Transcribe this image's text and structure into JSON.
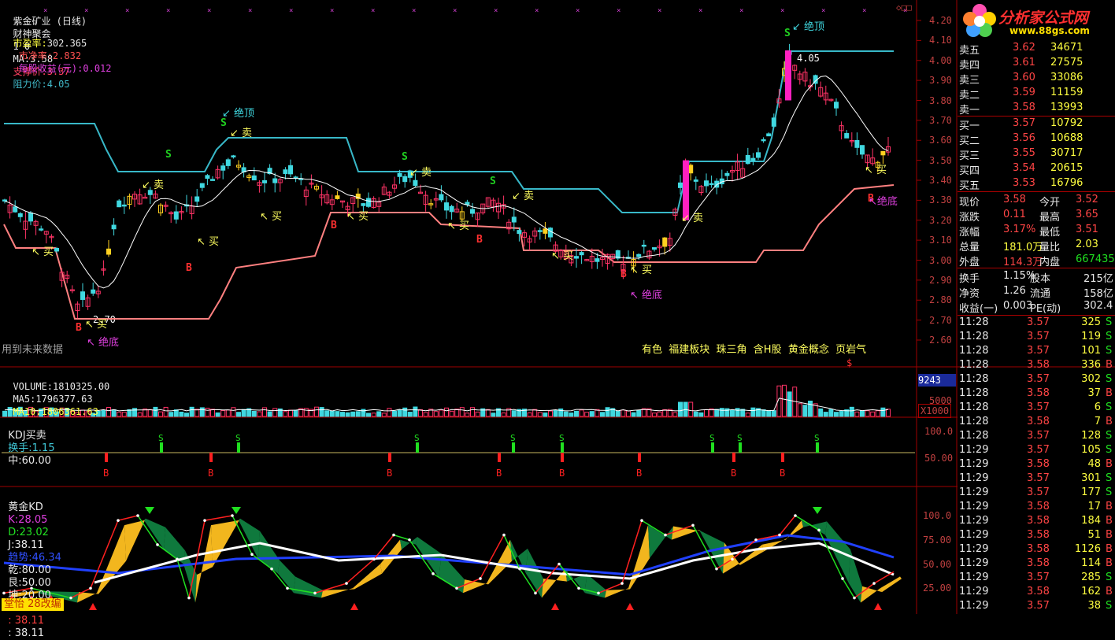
{
  "header": {
    "stock_name": "紫金矿业 (日线)",
    "indicator_name": "财神聚会",
    "params": "1 0",
    "ma_label": "MA:",
    "ma_value": "3.58",
    "support_label": "支撑价:",
    "support_value": "3.37",
    "resist_label": "阻力价:",
    "resist_value": "4.05",
    "pe_label": "市盈率:",
    "pe_value": "302.365",
    "pb_label": "市净率:",
    "pb_value": "2.832",
    "eps_label": "每股收益(元):",
    "eps_value": "0.012"
  },
  "main_chart": {
    "future_data_note": "用到未来数据",
    "concept_tags": [
      "有色",
      "福建板块",
      "珠三角",
      "含H股",
      "黄金概念",
      "页岩气"
    ],
    "concept_marker": "$",
    "high_label": "4.05",
    "low_label": "2.70",
    "y_ticks": [
      "4.20",
      "4.10",
      "4.00",
      "3.90",
      "3.80",
      "3.70",
      "3.60",
      "3.50",
      "3.40",
      "3.30",
      "3.20",
      "3.10",
      "3.00",
      "2.90",
      "2.80",
      "2.70",
      "2.60"
    ],
    "signals": [
      {
        "text": "↙ 绝顶",
        "kind": "top"
      },
      {
        "text": "↙ 绝顶",
        "kind": "top"
      },
      {
        "text": "↖ 绝底",
        "kind": "bottom"
      },
      {
        "text": "↖ 绝底",
        "kind": "bottom"
      },
      {
        "text": "↖绝底",
        "kind": "bottom"
      },
      {
        "text": "↙ 卖",
        "kind": "sell"
      },
      {
        "text": "↙ 卖",
        "kind": "sell"
      },
      {
        "text": "↙ 卖",
        "kind": "sell"
      },
      {
        "text": "↙ 卖",
        "kind": "sell"
      },
      {
        "text": "↙ 卖",
        "kind": "sell"
      },
      {
        "text": "↖ 买",
        "kind": "buy"
      },
      {
        "text": "↖ 买",
        "kind": "buy"
      },
      {
        "text": "↖ 买",
        "kind": "buy"
      },
      {
        "text": "↖ 买",
        "kind": "buy"
      },
      {
        "text": "↖ 买",
        "kind": "buy"
      },
      {
        "text": "↖ 买",
        "kind": "buy"
      },
      {
        "text": "↖ 买",
        "kind": "buy"
      },
      {
        "text": "↖ 买",
        "kind": "buy"
      },
      {
        "text": "↖ 买",
        "kind": "buy"
      }
    ],
    "s_marker": "S",
    "b_marker": "B"
  },
  "volume_panel": {
    "label": "VOLUME:",
    "value": "1810325.00",
    "ma5_label": "MA5:",
    "ma5_value": "1796377.63",
    "ma10_label": "MA10:",
    "ma10_value": "1806361.63",
    "axis_top": "9243",
    "axis_mid": "5000",
    "axis_unit": "X1000"
  },
  "kdj_panel": {
    "label": "KDJ买卖",
    "turnover_label": "换手:",
    "turnover_value": "1.15",
    "mid_label": "中:",
    "mid_value": "60.00",
    "y_ticks": [
      "100.0",
      "50.00"
    ]
  },
  "gold_kd_panel": {
    "label": "黄金KD",
    "k_label": "K:",
    "k_value": "28.05",
    "d_label": "D:",
    "d_value": "23.02",
    "j_label": "J:",
    "j_value": "38.11",
    "trend_label": "趋势:",
    "trend_value": "46.34",
    "qian_label": "乾:",
    "qian_value": "80.00",
    "gen_label": "艮:",
    "gen_value": "50.00",
    "kun_label": "坤:",
    "kun_value": "20.00",
    "extra1": ": 46.34",
    "extra2": ": 38.11",
    "extra3": ": 38.11",
    "y_ticks": [
      "100.0",
      "75.00",
      "50.00",
      "25.00"
    ],
    "credit": "堂怡 28改编"
  },
  "right_panel": {
    "logo_text": "分析家公式网",
    "logo_url": "www.88gs.com",
    "asks": [
      {
        "label": "卖五",
        "price": "3.62",
        "vol": "34671"
      },
      {
        "label": "卖四",
        "price": "3.61",
        "vol": "27575"
      },
      {
        "label": "卖三",
        "price": "3.60",
        "vol": "33086"
      },
      {
        "label": "卖二",
        "price": "3.59",
        "vol": "11159"
      },
      {
        "label": "卖一",
        "price": "3.58",
        "vol": "13993"
      }
    ],
    "bids": [
      {
        "label": "买一",
        "price": "3.57",
        "vol": "10792"
      },
      {
        "label": "买二",
        "price": "3.56",
        "vol": "10688"
      },
      {
        "label": "买三",
        "price": "3.55",
        "vol": "30717"
      },
      {
        "label": "买四",
        "price": "3.54",
        "vol": "20615"
      },
      {
        "label": "买五",
        "price": "3.53",
        "vol": "16796"
      }
    ],
    "quote": [
      {
        "l1": "现价",
        "v1": "3.58",
        "l2": "今开",
        "v2": "3.52"
      },
      {
        "l1": "涨跌",
        "v1": "0.11",
        "l2": "最高",
        "v2": "3.65"
      },
      {
        "l1": "涨幅",
        "v1": "3.17%",
        "l2": "最低",
        "v2": "3.51"
      },
      {
        "l1": "总量",
        "v1": "181.0万",
        "l2": "量比",
        "v2": "2.03"
      },
      {
        "l1": "外盘",
        "v1": "114.3万",
        "l2": "内盘",
        "v2": "667435"
      }
    ],
    "fundamentals": [
      {
        "l1": "换手",
        "v1": "1.15%",
        "l2": "股本",
        "v2": "215亿"
      },
      {
        "l1": "净资",
        "v1": "1.26",
        "l2": "流通",
        "v2": "158亿"
      },
      {
        "l1": "收益(一)",
        "v1": "0.003",
        "l2": "PE(动)",
        "v2": "302.4"
      }
    ],
    "ticks": [
      {
        "time": "11:28",
        "price": "3.57",
        "vol": "325",
        "side": "S"
      },
      {
        "time": "11:28",
        "price": "3.57",
        "vol": "119",
        "side": "S"
      },
      {
        "time": "11:28",
        "price": "3.57",
        "vol": "101",
        "side": "S"
      },
      {
        "time": "11:28",
        "price": "3.58",
        "vol": "336",
        "side": "B"
      },
      {
        "time": "11:28",
        "price": "3.57",
        "vol": "302",
        "side": "S"
      },
      {
        "time": "11:28",
        "price": "3.58",
        "vol": "37",
        "side": "B"
      },
      {
        "time": "11:28",
        "price": "3.57",
        "vol": "6",
        "side": "S"
      },
      {
        "time": "11:28",
        "price": "3.58",
        "vol": "7",
        "side": "B"
      },
      {
        "time": "11:28",
        "price": "3.57",
        "vol": "128",
        "side": "S"
      },
      {
        "time": "11:29",
        "price": "3.57",
        "vol": "105",
        "side": "S"
      },
      {
        "time": "11:29",
        "price": "3.58",
        "vol": "48",
        "side": "B"
      },
      {
        "time": "11:29",
        "price": "3.57",
        "vol": "301",
        "side": "S"
      },
      {
        "time": "11:29",
        "price": "3.57",
        "vol": "177",
        "side": "S"
      },
      {
        "time": "11:29",
        "price": "3.58",
        "vol": "17",
        "side": "B"
      },
      {
        "time": "11:29",
        "price": "3.58",
        "vol": "184",
        "side": "B"
      },
      {
        "time": "11:29",
        "price": "3.58",
        "vol": "51",
        "side": "B"
      },
      {
        "time": "11:29",
        "price": "3.58",
        "vol": "1126",
        "side": "B"
      },
      {
        "time": "11:29",
        "price": "3.58",
        "vol": "114",
        "side": "B"
      },
      {
        "time": "11:29",
        "price": "3.57",
        "vol": "285",
        "side": "S"
      },
      {
        "time": "11:29",
        "price": "3.58",
        "vol": "162",
        "side": "B"
      },
      {
        "time": "11:29",
        "price": "3.57",
        "vol": "38",
        "side": "S"
      }
    ]
  },
  "colors": {
    "up": "#ff3366",
    "down": "#40d8e0",
    "resist_line": "#38b8c8",
    "support_line": "#ff8080",
    "panel_border": "#a00000"
  }
}
